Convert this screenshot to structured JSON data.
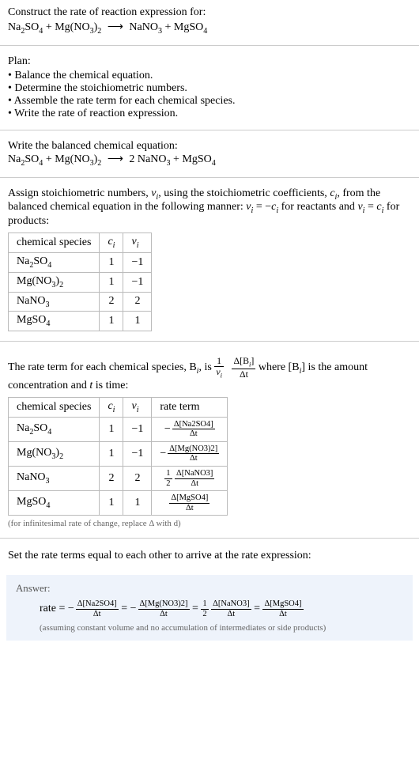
{
  "header": {
    "prompt": "Construct the rate of reaction expression for:",
    "equation_lhs1": "Na",
    "equation_lhs1_sub": "2",
    "equation_lhs1b": "SO",
    "equation_lhs1b_sub": "4",
    "plus1": " + ",
    "equation_lhs2": "Mg(NO",
    "equation_lhs2_sub": "3",
    "equation_lhs2b": ")",
    "equation_lhs2b_sub": "2",
    "arrow": "⟶",
    "equation_rhs1": "NaNO",
    "equation_rhs1_sub": "3",
    "plus2": " + ",
    "equation_rhs2": "MgSO",
    "equation_rhs2_sub": "4"
  },
  "plan": {
    "head": "Plan:",
    "items": [
      "• Balance the chemical equation.",
      "• Determine the stoichiometric numbers.",
      "• Assemble the rate term for each chemical species.",
      "• Write the rate of reaction expression."
    ]
  },
  "balanced": {
    "head": "Write the balanced chemical equation:",
    "coef_nano3": "2 "
  },
  "assign": {
    "text_a": "Assign stoichiometric numbers, ",
    "nu_i": "ν",
    "nu_i_sub": "i",
    "text_b": ", using the stoichiometric coefficients, ",
    "c_i": "c",
    "c_i_sub": "i",
    "text_c": ", from the balanced chemical equation in the following manner: ",
    "rel1_l": "ν",
    "rel1_l_sub": "i",
    "rel1_eq": " = −",
    "rel1_r": "c",
    "rel1_r_sub": "i",
    "text_d": " for reactants and ",
    "rel2_l": "ν",
    "rel2_l_sub": "i",
    "rel2_eq": " = ",
    "rel2_r": "c",
    "rel2_r_sub": "i",
    "text_e": " for products:"
  },
  "table1": {
    "h1": "chemical species",
    "h2": "c",
    "h2_sub": "i",
    "h3": "ν",
    "h3_sub": "i",
    "rows": [
      {
        "species_a": "Na",
        "sa_sub": "2",
        "species_b": "SO",
        "sb_sub": "4",
        "c": "1",
        "nu": "−1"
      },
      {
        "species_a": "Mg(NO",
        "sa_sub": "3",
        "species_b": ")",
        "sb_sub": "2",
        "c": "1",
        "nu": "−1"
      },
      {
        "species_a": "NaNO",
        "sa_sub": "3",
        "species_b": "",
        "sb_sub": "",
        "c": "2",
        "nu": "2"
      },
      {
        "species_a": "MgSO",
        "sa_sub": "4",
        "species_b": "",
        "sb_sub": "",
        "c": "1",
        "nu": "1"
      }
    ]
  },
  "rate_intro": {
    "a": "The rate term for each chemical species, B",
    "a_sub": "i",
    "b": ", is ",
    "frac1_num": "1",
    "frac1_den_a": "ν",
    "frac1_den_sub": "i",
    "frac2_num": "Δ[B",
    "frac2_num_sub": "i",
    "frac2_num_close": "]",
    "frac2_den": "Δt",
    "c": " where [B",
    "c_sub": "i",
    "c2": "] is the amount concentration and ",
    "t": "t",
    "d": " is time:"
  },
  "table2": {
    "h1": "chemical species",
    "h2": "c",
    "h2_sub": "i",
    "h3": "ν",
    "h3_sub": "i",
    "h4": "rate term",
    "rows": [
      {
        "sp_a": "Na",
        "sa_sub": "2",
        "sp_b": "SO",
        "sb_sub": "4",
        "c": "1",
        "nu": "−1",
        "neg": "−",
        "num": "Δ[Na2SO4]",
        "den": "Δt",
        "pref": ""
      },
      {
        "sp_a": "Mg(NO",
        "sa_sub": "3",
        "sp_b": ")",
        "sb_sub": "2",
        "c": "1",
        "nu": "−1",
        "neg": "−",
        "num": "Δ[Mg(NO3)2]",
        "den": "Δt",
        "pref": ""
      },
      {
        "sp_a": "NaNO",
        "sa_sub": "3",
        "sp_b": "",
        "sb_sub": "",
        "c": "2",
        "nu": "2",
        "neg": "",
        "num": "Δ[NaNO3]",
        "den": "Δt",
        "pref_num": "1",
        "pref_den": "2"
      },
      {
        "sp_a": "MgSO",
        "sa_sub": "4",
        "sp_b": "",
        "sb_sub": "",
        "c": "1",
        "nu": "1",
        "neg": "",
        "num": "Δ[MgSO4]",
        "den": "Δt",
        "pref": ""
      }
    ],
    "note": "(for infinitesimal rate of change, replace Δ with d)"
  },
  "set_terms": "Set the rate terms equal to each other to arrive at the rate expression:",
  "answer": {
    "label": "Answer:",
    "rate": "rate = ",
    "neg": "−",
    "t1_num": "Δ[Na2SO4]",
    "t1_den": "Δt",
    "eq": " = ",
    "t2_num": "Δ[Mg(NO3)2]",
    "t2_den": "Δt",
    "half_num": "1",
    "half_den": "2",
    "t3_num": "Δ[NaNO3]",
    "t3_den": "Δt",
    "t4_num": "Δ[MgSO4]",
    "t4_den": "Δt",
    "note": "(assuming constant volume and no accumulation of intermediates or side products)"
  },
  "chart_data": {
    "type": "table",
    "tables": [
      {
        "title": "Stoichiometric numbers",
        "columns": [
          "chemical species",
          "c_i",
          "ν_i"
        ],
        "rows": [
          [
            "Na2SO4",
            1,
            -1
          ],
          [
            "Mg(NO3)2",
            1,
            -1
          ],
          [
            "NaNO3",
            2,
            2
          ],
          [
            "MgSO4",
            1,
            1
          ]
        ]
      },
      {
        "title": "Rate terms",
        "columns": [
          "chemical species",
          "c_i",
          "ν_i",
          "rate term"
        ],
        "rows": [
          [
            "Na2SO4",
            1,
            -1,
            "-Δ[Na2SO4]/Δt"
          ],
          [
            "Mg(NO3)2",
            1,
            -1,
            "-Δ[Mg(NO3)2]/Δt"
          ],
          [
            "NaNO3",
            2,
            2,
            "(1/2) Δ[NaNO3]/Δt"
          ],
          [
            "MgSO4",
            1,
            1,
            "Δ[MgSO4]/Δt"
          ]
        ]
      }
    ]
  }
}
